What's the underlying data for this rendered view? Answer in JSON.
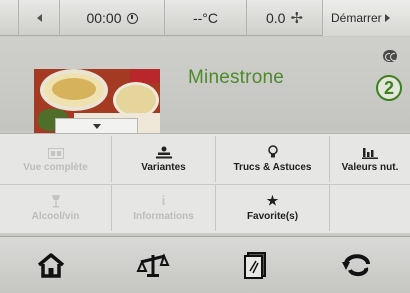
{
  "statusbar": {
    "time": "00:00",
    "temperature": "--°C",
    "speed": "0.0",
    "start_label": "Démarrer"
  },
  "recipe": {
    "title": "Minestrone",
    "step_badge": "2"
  },
  "menu": {
    "row1": [
      {
        "label": "Vue complète",
        "icon": "list-icon",
        "enabled": false
      },
      {
        "label": "Variantes",
        "icon": "variants-icon",
        "enabled": true
      },
      {
        "label": "Trucs & Astuces",
        "icon": "lightbulb-icon",
        "enabled": true
      },
      {
        "label": "Valeurs nut.",
        "icon": "bar-chart-icon",
        "enabled": true
      }
    ],
    "row2": [
      {
        "label": "Alcool/vin",
        "icon": "wine-glass-icon",
        "enabled": false
      },
      {
        "label": "Informations",
        "icon": "info-icon",
        "enabled": false
      },
      {
        "label": "Favorite(s)",
        "icon": "star-icon",
        "enabled": true
      }
    ]
  },
  "navbar": {
    "items": [
      "home-icon",
      "scale-icon",
      "recipe-book-icon",
      "back-icon"
    ]
  },
  "colors": {
    "title_green": "#4c8a2a",
    "badge_green": "#3f7f20"
  }
}
